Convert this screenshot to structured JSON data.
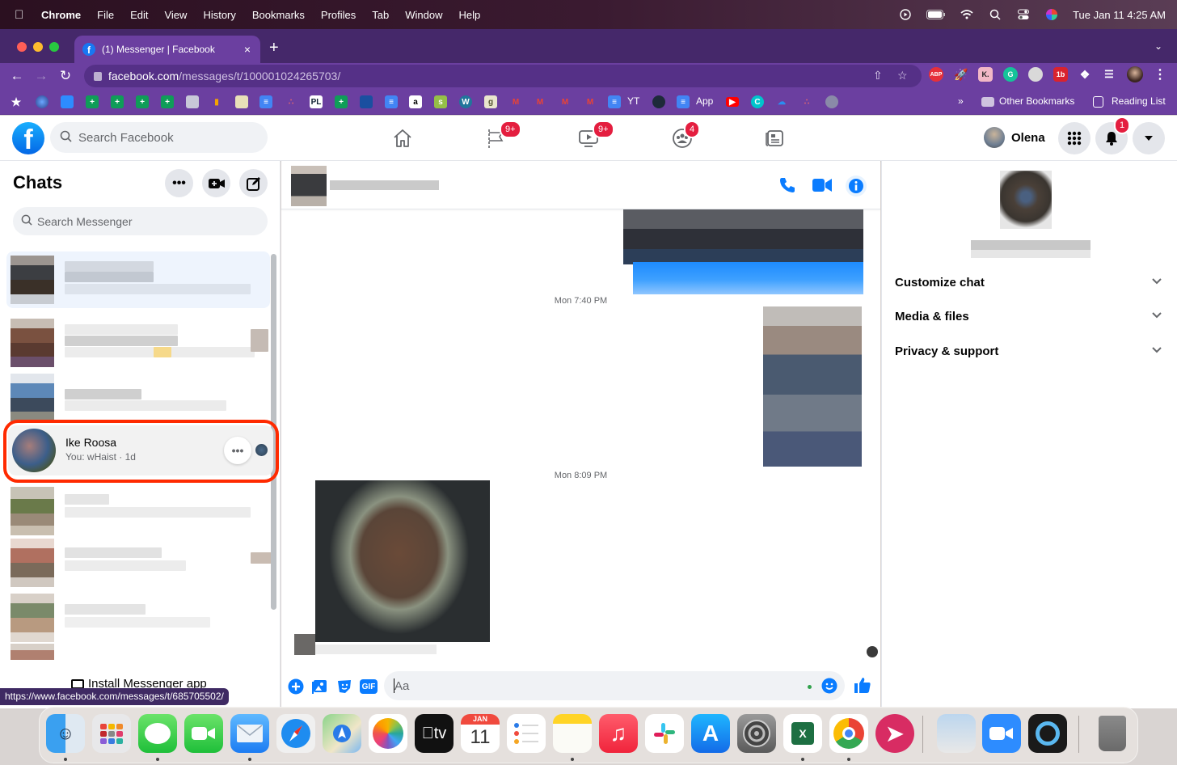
{
  "menubar": {
    "items": [
      "Chrome",
      "File",
      "Edit",
      "View",
      "History",
      "Bookmarks",
      "Profiles",
      "Tab",
      "Window",
      "Help"
    ],
    "clock": "Tue Jan 11  4:25 AM",
    "status_icons": [
      "play-circle-icon",
      "battery-icon",
      "wifi-icon",
      "spotlight-search-icon",
      "control-center-icon",
      "siri-icon"
    ]
  },
  "browser": {
    "tab_title": "(1) Messenger | Facebook",
    "url_host": "facebook.com",
    "url_path": "/messages/t/100001024265703/",
    "new_tab_label": "+",
    "tab_close_label": "×",
    "extensions": [
      "ABP",
      "K.",
      "G",
      "1b"
    ],
    "bookmarks": {
      "labeled": [
        "YT",
        "App"
      ],
      "overflow_label": "»",
      "other_bookmarks": "Other Bookmarks",
      "reading_list": "Reading List"
    },
    "status_url": "https://www.facebook.com/messages/t/685705502/"
  },
  "facebook": {
    "search_placeholder": "Search Facebook",
    "nav_badges": {
      "pages": "9+",
      "watch": "9+",
      "groups": "4"
    },
    "profile_name": "Olena",
    "notification_count": "1",
    "colors": {
      "brand": "#1877f2",
      "accent": "#0a7cff",
      "badge": "#e41e3f",
      "highlight": "#ff2a00"
    }
  },
  "sidebar": {
    "title": "Chats",
    "search_placeholder": "Search Messenger",
    "highlighted_chat": {
      "name": "Ike Roosa",
      "preview": "You: wHaist · 1d",
      "more_label": "•••"
    },
    "install_label": "Install Messenger app"
  },
  "conversation": {
    "timestamps": [
      "Mon 7:40 PM",
      "Mon 8:09 PM"
    ],
    "composer_placeholder": "Aa",
    "composer_gif_label": "GIF"
  },
  "info_panel": {
    "sections": [
      {
        "label": "Customize chat"
      },
      {
        "label": "Media & files"
      },
      {
        "label": "Privacy & support"
      }
    ]
  },
  "dock": {
    "apps": [
      "Finder",
      "Launchpad",
      "Messages",
      "FaceTime",
      "Mail",
      "Safari",
      "Maps",
      "Photos",
      "TV",
      "Calendar",
      "Reminders",
      "Notes",
      "Music",
      "Slack",
      "App Store",
      "System Preferences",
      "Excel",
      "Chrome",
      "Airmail",
      "Preview",
      "Zoom",
      "QuickTime Player",
      "Trash"
    ],
    "calendar_month": "JAN",
    "calendar_day": "11",
    "tv_label": "tv"
  }
}
